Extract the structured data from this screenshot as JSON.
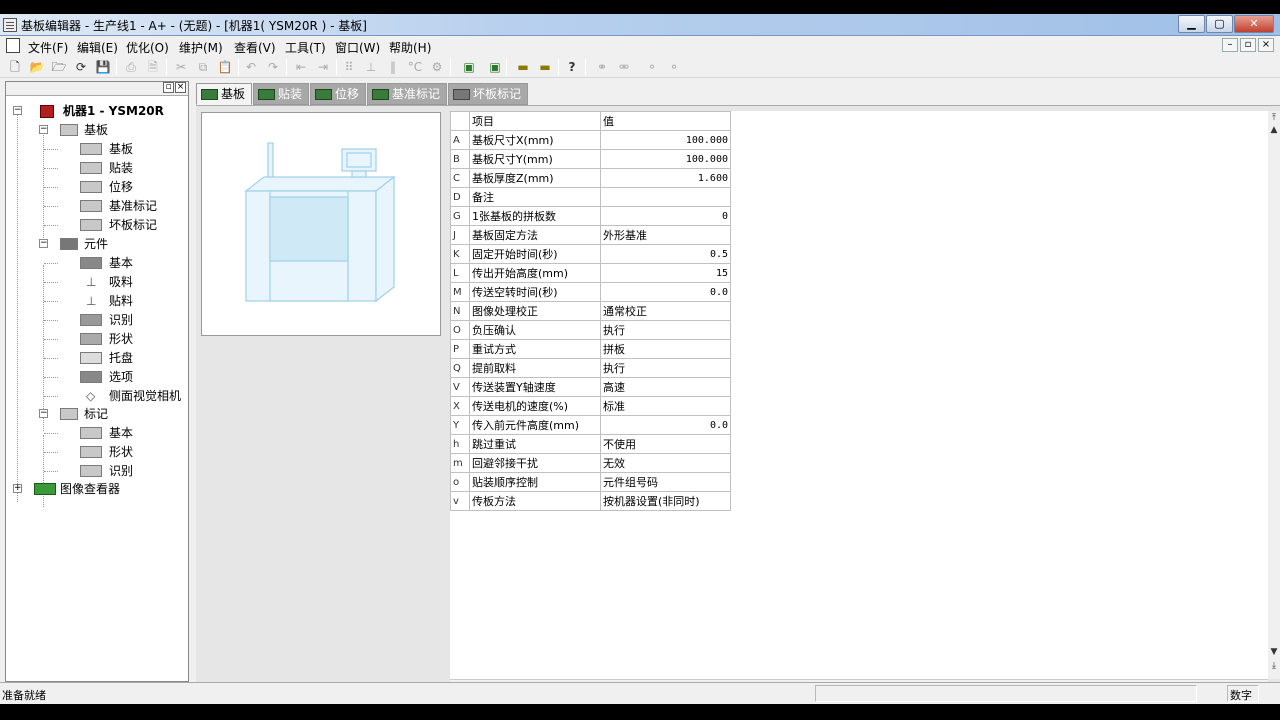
{
  "window": {
    "title": "基板编辑器 - 生产线1 - A+ - (无题) - [机器1( YSM20R ) - 基板]",
    "minimize": "0",
    "maximize": "1",
    "close": "r"
  },
  "menubar": {
    "items": [
      "文件(F)",
      "编辑(E)",
      "优化(O)",
      "维护(M)",
      "查看(V)",
      "工具(T)",
      "窗口(W)",
      "帮助(H)"
    ],
    "mdi": [
      "–",
      "▫",
      "×"
    ]
  },
  "tree": {
    "root": "机器1 - YSM20R",
    "groups": [
      {
        "label": "基板",
        "children": [
          "基板",
          "贴装",
          "位移",
          "基准标记",
          "坏板标记"
        ]
      },
      {
        "label": "元件",
        "children": [
          "基本",
          "吸料",
          "贴料",
          "识别",
          "形状",
          "托盘",
          "选项",
          "侧面视觉相机"
        ]
      },
      {
        "label": "标记",
        "children": [
          "基本",
          "形状",
          "识别"
        ]
      }
    ],
    "image_viewer": "图像查看器"
  },
  "tabs": [
    "基板",
    "贴装",
    "位移",
    "基准标记",
    "坏板标记"
  ],
  "grid": {
    "headers": [
      "项目",
      "值"
    ],
    "rows": [
      {
        "key": "A",
        "item": "基板尺寸X(mm)",
        "value": "100.000",
        "numeric": true
      },
      {
        "key": "B",
        "item": "基板尺寸Y(mm)",
        "value": "100.000",
        "numeric": true
      },
      {
        "key": "C",
        "item": "基板厚度Z(mm)",
        "value": "1.600",
        "numeric": true
      },
      {
        "key": "D",
        "item": "备注",
        "value": "",
        "numeric": false
      },
      {
        "key": "G",
        "item": "1张基板的拼板数",
        "value": "0",
        "numeric": true
      },
      {
        "key": "J",
        "item": "基板固定方法",
        "value": "外形基准",
        "numeric": false
      },
      {
        "key": "K",
        "item": "固定开始时间(秒)",
        "value": "0.5",
        "numeric": true
      },
      {
        "key": "L",
        "item": "传出开始高度(mm)",
        "value": "15",
        "numeric": true
      },
      {
        "key": "M",
        "item": "传送空转时间(秒)",
        "value": "0.0",
        "numeric": true
      },
      {
        "key": "N",
        "item": "图像处理校正",
        "value": "通常校正",
        "numeric": false
      },
      {
        "key": "O",
        "item": "负压确认",
        "value": "执行",
        "numeric": false
      },
      {
        "key": "P",
        "item": "重试方式",
        "value": "拼板",
        "numeric": false
      },
      {
        "key": "Q",
        "item": "提前取料",
        "value": "执行",
        "numeric": false
      },
      {
        "key": "V",
        "item": "传送装置Y轴速度",
        "value": "高速",
        "numeric": false
      },
      {
        "key": "X",
        "item": "传送电机的速度(%)",
        "value": "标准",
        "numeric": false
      },
      {
        "key": "Y",
        "item": "传入前元件高度(mm)",
        "value": "0.0",
        "numeric": true
      },
      {
        "key": "h",
        "item": "跳过重试",
        "value": "不使用",
        "numeric": false
      },
      {
        "key": "m",
        "item": "回避邻接干扰",
        "value": "无效",
        "numeric": false
      },
      {
        "key": "o",
        "item": "贴装顺序控制",
        "value": "元件组号码",
        "numeric": false
      },
      {
        "key": "v",
        "item": "传板方法",
        "value": "按机器设置(非同时)",
        "numeric": false
      }
    ]
  },
  "status": {
    "message": "准备就绪",
    "mode": "数字"
  },
  "colors": {
    "accent_green": "#3a7a3a",
    "machine_outline": "#9fd0ec",
    "tab_inactive": "#a8a8a8"
  }
}
